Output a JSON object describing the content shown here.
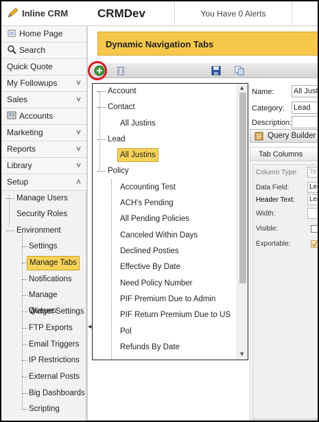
{
  "header": {
    "logo_text": "Inline CRM",
    "app_title": "CRMDev",
    "alerts_text": "You Have 0 Alerts"
  },
  "sidebar": {
    "items": [
      {
        "label": "Home Page",
        "icon": "home-icon"
      },
      {
        "label": "Search",
        "icon": "search-icon"
      },
      {
        "label": "Quick Quote"
      },
      {
        "label": "My Followups",
        "chevron": "˅"
      },
      {
        "label": "Sales",
        "chevron": "˅"
      },
      {
        "label": "Accounts",
        "icon": "accounts-icon"
      },
      {
        "label": "Marketing",
        "chevron": "˅"
      },
      {
        "label": "Reports",
        "chevron": "˅"
      },
      {
        "label": "Library",
        "chevron": "˅"
      },
      {
        "label": "Setup",
        "chevron": "˄"
      }
    ],
    "setup_children": [
      "Manage Users",
      "Security Roles",
      "Environment"
    ],
    "environment_children": [
      "Settings",
      "Manage Tabs",
      "Notifications",
      "Manage Queues",
      "Widget Settings",
      "FTP Exports",
      "Email Triggers",
      "IP Restrictions",
      "External Posts",
      "Big Dashboards",
      "Scripting"
    ],
    "selected": "Manage Tabs"
  },
  "content": {
    "title": "Dynamic Navigation Tabs",
    "tree": {
      "nodes": [
        {
          "label": "Account",
          "level": 0
        },
        {
          "label": "Contact",
          "level": 0
        },
        {
          "label": "All Justins",
          "level": 1
        },
        {
          "label": "Lead",
          "level": 0
        },
        {
          "label": "All Justins",
          "level": 1,
          "selected": true
        },
        {
          "label": "Policy",
          "level": 0
        },
        {
          "label": "Accounting Test",
          "level": 1
        },
        {
          "label": "ACH's Pending",
          "level": 1
        },
        {
          "label": "All Pending Policies",
          "level": 1
        },
        {
          "label": "Canceled Within Days",
          "level": 1
        },
        {
          "label": "Declined Posties",
          "level": 1
        },
        {
          "label": "Effective By Date",
          "level": 1
        },
        {
          "label": "Need Policy Number",
          "level": 1
        },
        {
          "label": "PIF Premium Due to Admin",
          "level": 1
        },
        {
          "label": "PIF Return Premium Due to US",
          "level": 1
        },
        {
          "label": "Pol",
          "level": 1
        },
        {
          "label": "Refunds By Date",
          "level": 1
        }
      ]
    },
    "props": {
      "name_label": "Name:",
      "name_value": "All Justins",
      "category_label": "Category:",
      "category_value": "Lead",
      "description_label": "Description:",
      "description_value": "",
      "query_builder_label": "Query Builder",
      "tab_columns_label": "Tab Columns",
      "column_type_label": "Column Type:",
      "column_type_value": "Text",
      "data_field_label": "Data Field:",
      "data_field_value": "Lead",
      "header_text_label": "Header Text:",
      "header_text_value": "Lead",
      "width_label": "Width:",
      "width_value": "",
      "visible_label": "Visible:",
      "exportable_label": "Exportable:"
    }
  },
  "colors": {
    "accent": "#f5c84b",
    "selection": "#f7d358",
    "highlight_ring": "#e0161b"
  }
}
